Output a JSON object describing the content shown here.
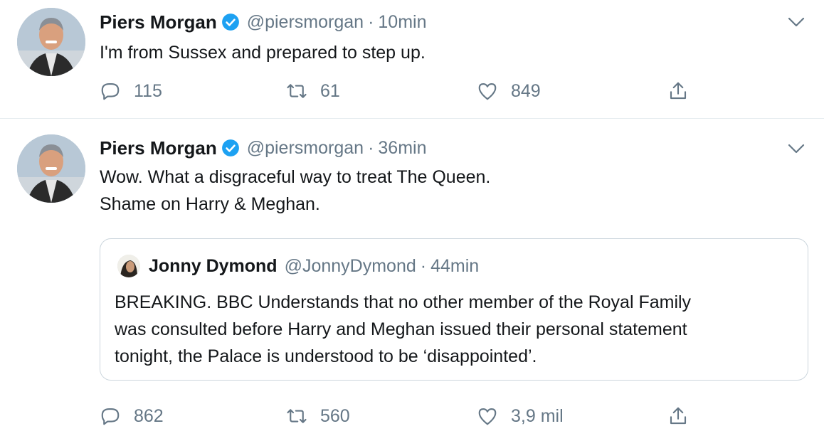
{
  "tweets": [
    {
      "author_name": "Piers Morgan",
      "handle": "@piersmorgan",
      "separator": "·",
      "time": "10min",
      "text_lines": [
        "I'm from Sussex and prepared to step up."
      ],
      "reply_count": "115",
      "retweet_count": "61",
      "like_count": "849"
    },
    {
      "author_name": "Piers Morgan",
      "handle": "@piersmorgan",
      "separator": "·",
      "time": "36min",
      "text_lines": [
        "Wow. What a disgraceful way to treat The Queen.",
        "Shame on Harry & Meghan."
      ],
      "quoted": {
        "author_name": "Jonny Dymond",
        "handle": "@JonnyDymond",
        "separator": "·",
        "time": "44min",
        "text_lines": [
          "BREAKING. BBC Understands that no other member of the Royal Family",
          "was consulted before Harry and Meghan issued their personal statement",
          "tonight, the Palace is understood to be ‘disappointed’."
        ]
      },
      "reply_count": "862",
      "retweet_count": "560",
      "like_count": "3,9 mil"
    }
  ],
  "icons": {
    "reply": "reply-icon",
    "retweet": "retweet-icon",
    "like": "heart-icon",
    "share": "share-icon",
    "verified": "verified-badge-icon",
    "caret": "chevron-down-icon"
  },
  "colors": {
    "text_primary": "#14171a",
    "text_secondary": "#657786",
    "verified_blue": "#1da1f2",
    "divider": "#e6ecf0",
    "quote_border": "#ccd6dd"
  }
}
